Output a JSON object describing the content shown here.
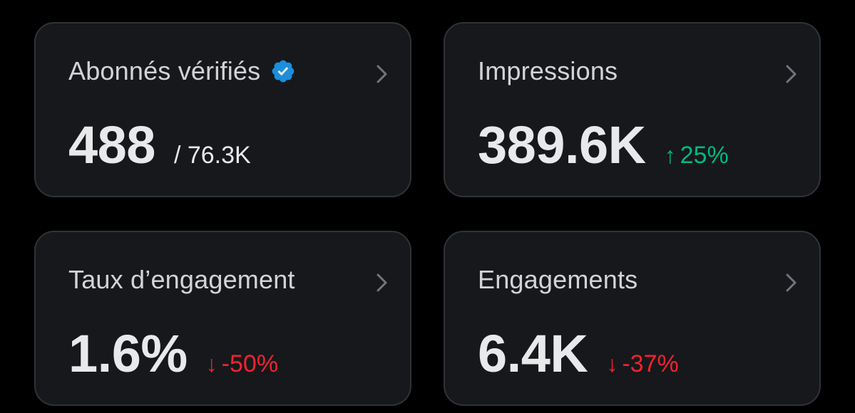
{
  "cards": [
    {
      "title": "Abonnés vérifiés",
      "value": "488",
      "total": "/ 76.3K",
      "verified_badge_color": "#1d9bf0"
    },
    {
      "title": "Impressions",
      "value": "389.6K",
      "delta_arrow": "↑",
      "delta": "25%",
      "delta_color": "#00ba7c"
    },
    {
      "title": "Taux d’engagement",
      "value": "1.6%",
      "delta_arrow": "↓",
      "delta": "-50%",
      "delta_color": "#f4212e"
    },
    {
      "title": "Engagements",
      "value": "6.4K",
      "delta_arrow": "↓",
      "delta": "-37%",
      "delta_color": "#f4212e"
    }
  ],
  "icons": {
    "verified": "verified-badge-icon",
    "chevron": "chevron-right-icon"
  }
}
